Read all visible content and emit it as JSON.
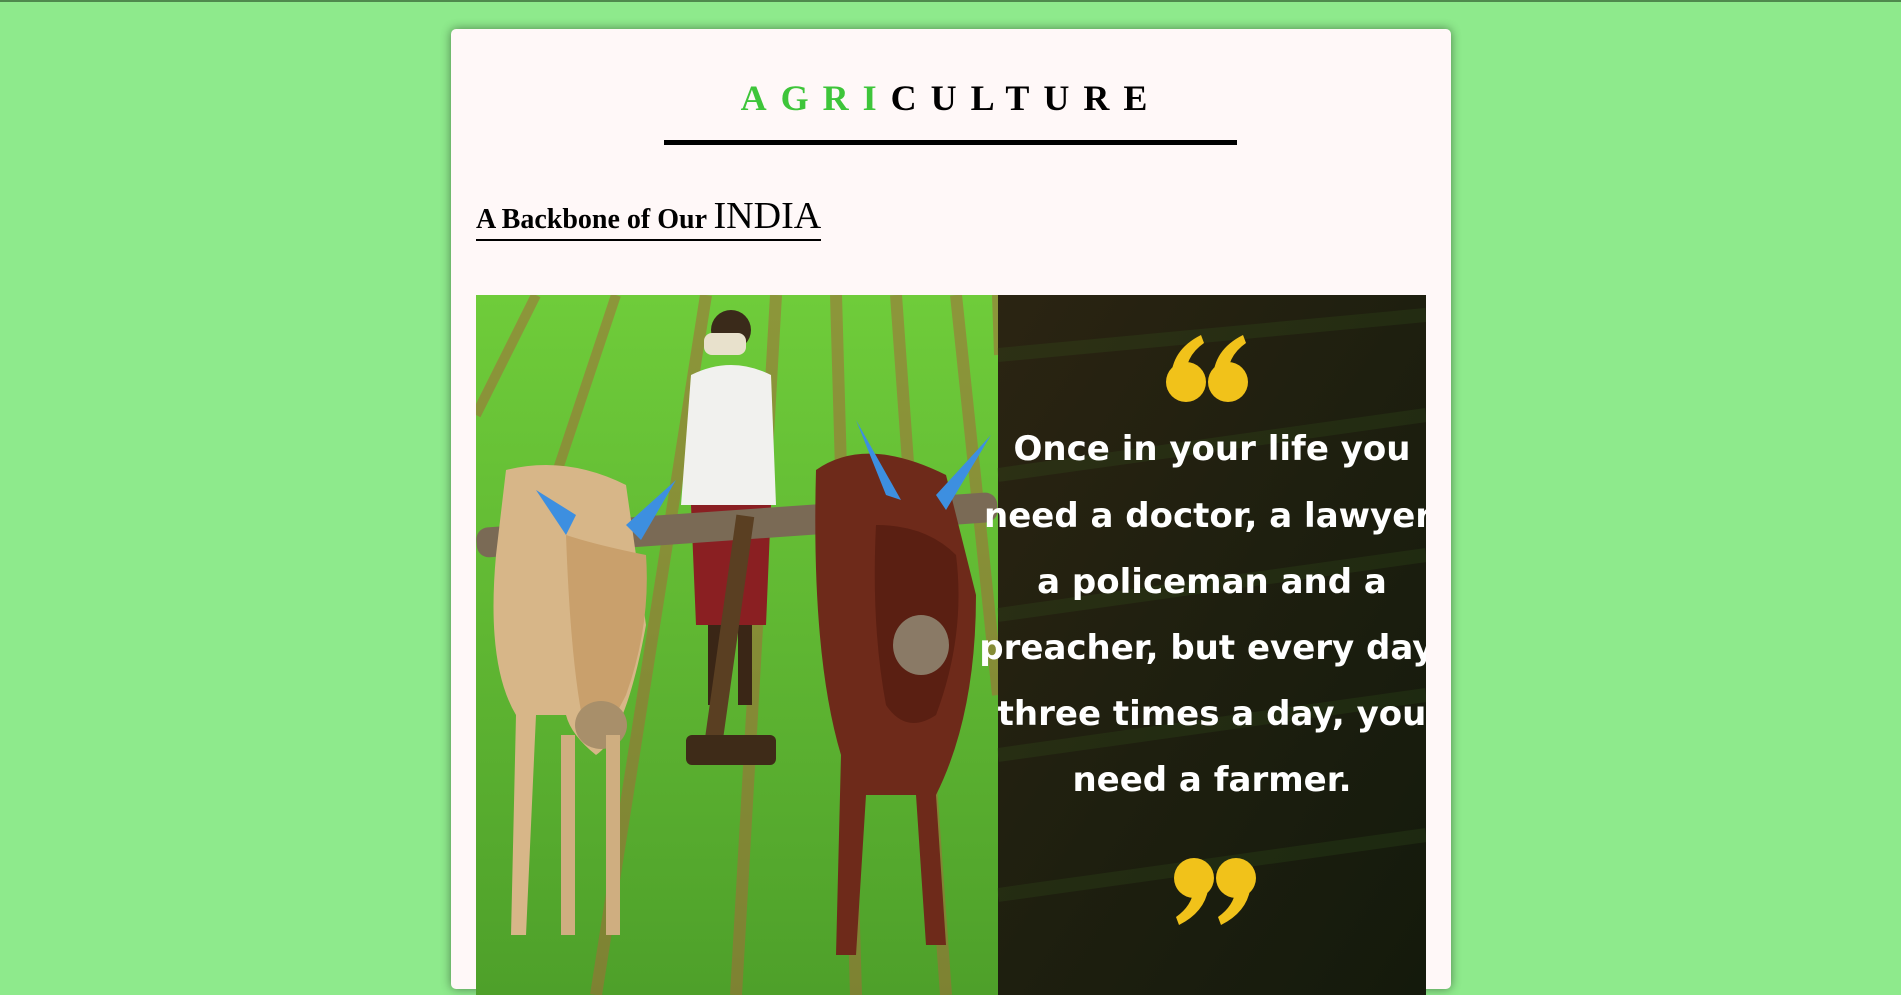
{
  "header": {
    "title_green": "AGRI",
    "title_rest": "CULTURE"
  },
  "tagline": {
    "prefix": "A Backbone of Our",
    "emphasis": "INDIA"
  },
  "hero_image": {
    "description_icon": "farmer-plough-photo",
    "quote_lines": [
      "Once in your life you",
      "need a doctor, a lawyer,",
      "a policeman and a",
      "preacher, but every day,",
      "three times a day, you",
      "need a farmer."
    ]
  },
  "colors": {
    "page_background": "#8eea8c",
    "card_background": "#fff8f8",
    "accent_green": "#3ec53a",
    "quote_mark": "#f1c21a"
  }
}
